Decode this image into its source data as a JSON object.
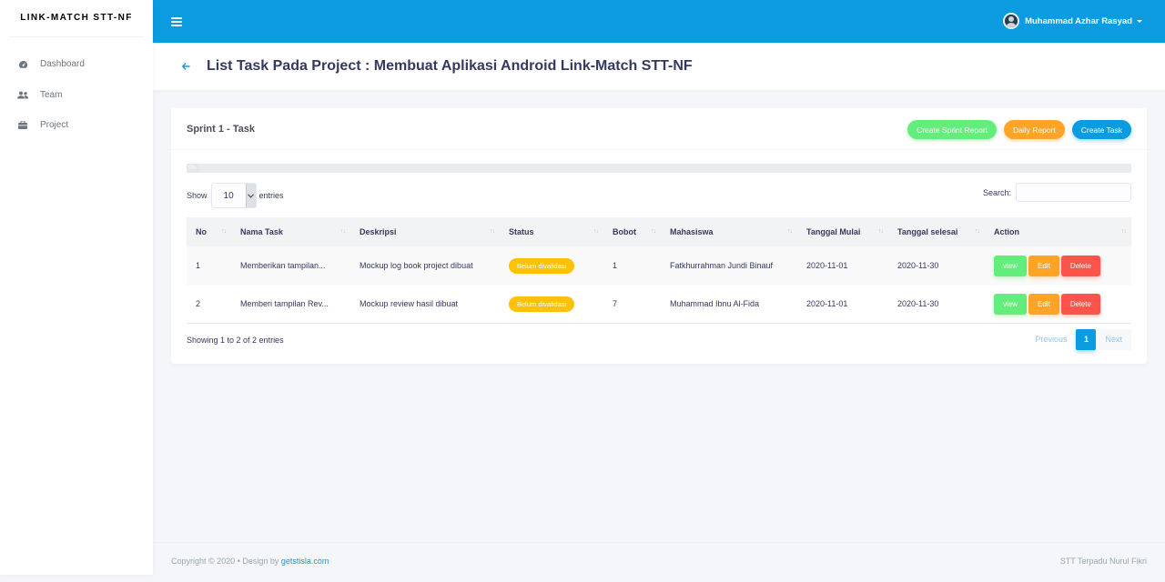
{
  "brand": "LINK-MATCH STT-NF",
  "sidebar": {
    "items": [
      {
        "label": "Dashboard",
        "icon": "dashboard-icon"
      },
      {
        "label": "Team",
        "icon": "users-icon"
      },
      {
        "label": "Project",
        "icon": "briefcase-icon"
      }
    ]
  },
  "header": {
    "user_name": "Muhammad Azhar Rasyad"
  },
  "page": {
    "title": "List Task Pada Project : Membuat Aplikasi Android Link-Match STT-NF"
  },
  "card": {
    "title": "Sprint 1 - Task",
    "buttons": {
      "sprint_report": "Create Sprint Report",
      "daily_report": "Daily Report",
      "create_task": "Create Task"
    },
    "progress": {
      "value": 0,
      "label": "0%"
    },
    "show_label": "Show",
    "entries_value": "10",
    "entries_label": "entries",
    "search_label": "Search:"
  },
  "table": {
    "columns": [
      "No",
      "Nama Task",
      "Deskripsi",
      "Status",
      "Bobot",
      "Mahasiswa",
      "Tanggal Mulai",
      "Tanggal selesai",
      "Action"
    ],
    "rows": [
      {
        "no": "1",
        "task": "Memberikan tampilan...",
        "desc": "Mockup log book project dibuat",
        "status": "Belum divalidasi",
        "bobot": "1",
        "mhs": "Fatkhurrahman Jundi Binauf",
        "mulai": "2020-11-01",
        "selesai": "2020-11-30"
      },
      {
        "no": "2",
        "task": "Memberi tampilan Rev...",
        "desc": "Mockup review hasil dibuat",
        "status": "Belum divalidasi",
        "bobot": "7",
        "mhs": "Muhammad Ibnu Al-Fida",
        "mulai": "2020-11-01",
        "selesai": "2020-11-30"
      }
    ],
    "actions": {
      "view": "view",
      "edit": "Edit",
      "delete": "Delete"
    }
  },
  "pagination": {
    "info": "Showing 1 to 2 of 2 entries",
    "previous": "Previous",
    "current": "1",
    "next": "Next"
  },
  "footer": {
    "copyright": "Copyright © 2020",
    "design_by": "Design by",
    "design_link": "getstisla.com",
    "right": "STT Terpadu Nurul Fikri"
  }
}
